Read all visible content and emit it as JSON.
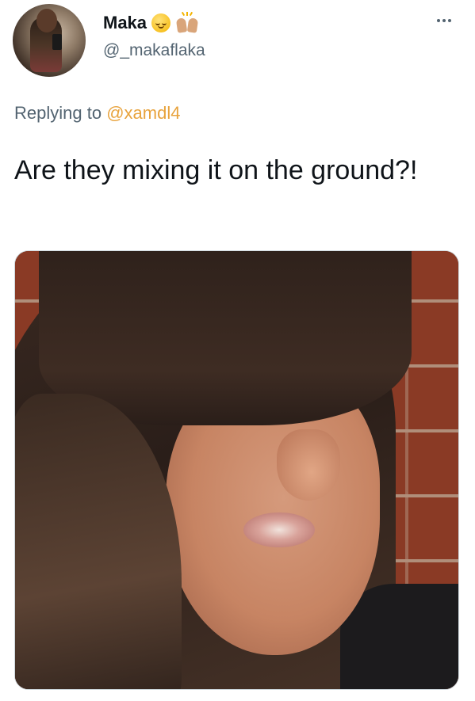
{
  "tweet": {
    "author": {
      "display_name": "Maka",
      "emojis": [
        "relieved-face-emoji",
        "raising-hands-emoji"
      ],
      "handle": "@_makaflaka"
    },
    "replying_to": {
      "prefix": "Replying to",
      "handle": "@xamdl4"
    },
    "text": "Are they mixing it on the ground?!",
    "more_icon": "more-horizontal-icon",
    "colors": {
      "text": "#0f1419",
      "muted": "#536471",
      "mention": "#e8a33d"
    }
  }
}
